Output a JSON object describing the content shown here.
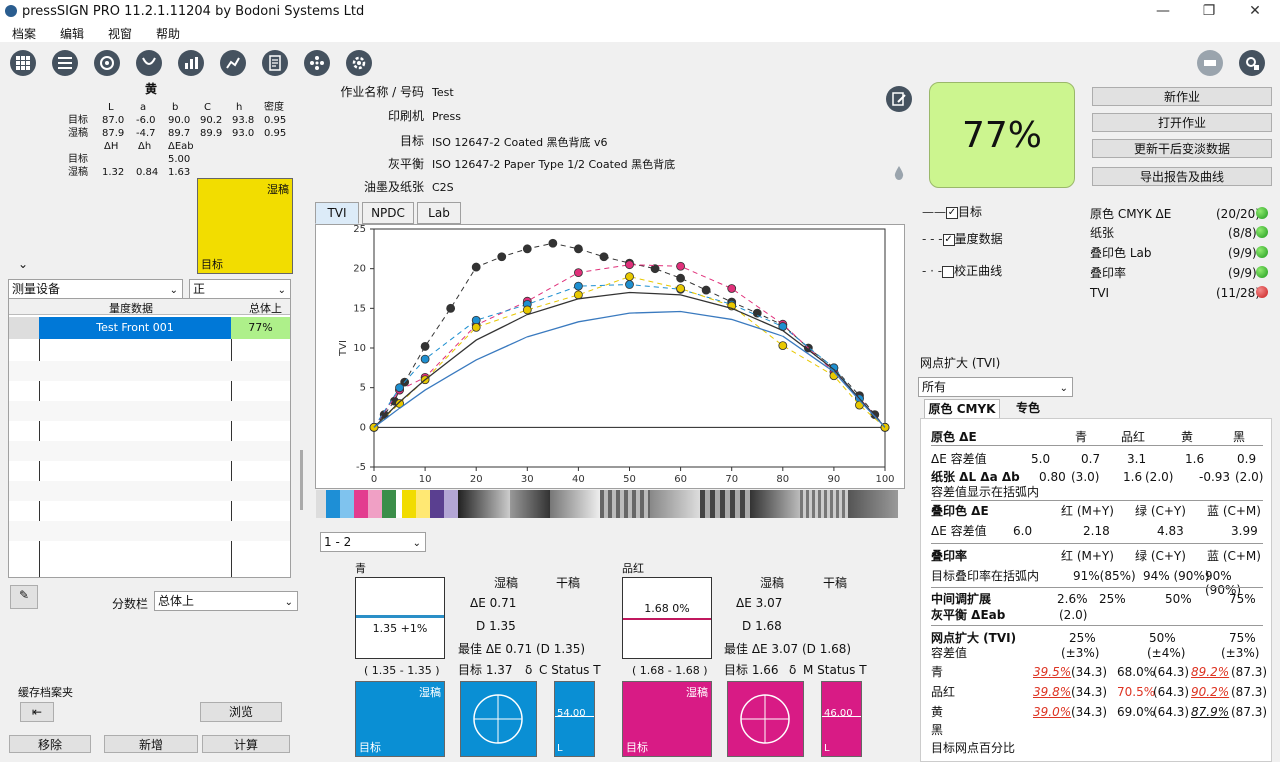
{
  "app": {
    "title": "pressSIGN PRO 11.2.1.11204 by Bodoni Systems Ltd"
  },
  "menu": [
    "档案",
    "编辑",
    "视窗",
    "帮助"
  ],
  "left": {
    "color_name": "黄",
    "headers": [
      "L",
      "a",
      "b",
      "C",
      "h",
      "密度"
    ],
    "target_label": "目标",
    "target": [
      "87.0",
      "-6.0",
      "90.0",
      "90.2",
      "93.8",
      "0.95"
    ],
    "wet_label": "湿稿",
    "wet": [
      "87.9",
      "-4.7",
      "89.7",
      "89.9",
      "93.0",
      "0.95"
    ],
    "d_headers": [
      "ΔH",
      "Δh",
      "ΔEab"
    ],
    "d_target_label": "目标",
    "d_target": [
      "",
      "",
      "5.00"
    ],
    "d_wet_label": "湿稿",
    "d_wet": [
      "1.32",
      "0.84",
      "1.63"
    ],
    "swatch_wet": "湿稿",
    "swatch_target": "目标",
    "device": "测量设备",
    "side": "正",
    "list_h1": "量度数据",
    "list_h2": "总体上",
    "row_name": "Test Front 001",
    "row_score": "77%",
    "score_label": "分数栏",
    "score_value": "总体上",
    "cache_label": "缓存档案夹",
    "browse": "浏览",
    "remove": "移除",
    "add": "新增",
    "calc": "计算"
  },
  "job": {
    "name_label": "作业名称 / 号码",
    "name": "Test",
    "press_label": "印刷机",
    "press": "Press",
    "target_label": "目标",
    "target": "ISO 12647-2 Coated 黑色背底 v6",
    "gray_label": "灰平衡",
    "gray": "ISO 12647-2 Paper Type 1/2 Coated 黑色背底",
    "ink_label": "油墨及纸张",
    "ink": "C2S"
  },
  "score": "77%",
  "buttons": [
    "新作业",
    "打开作业",
    "更新干后变淡数据",
    "导出报告及曲线"
  ],
  "tabs": [
    "TVI",
    "NPDC",
    "Lab"
  ],
  "chart_data": {
    "type": "line",
    "ylabel": "TVI",
    "xlim": [
      0,
      100
    ],
    "ylim": [
      -5,
      25
    ],
    "xticks": [
      0,
      10,
      20,
      30,
      40,
      50,
      60,
      70,
      80,
      90,
      100
    ],
    "yticks": [
      -5,
      0,
      5,
      10,
      15,
      20,
      25
    ],
    "x": [
      0,
      2,
      4,
      5,
      6,
      10,
      15,
      20,
      25,
      30,
      35,
      40,
      45,
      50,
      55,
      60,
      65,
      70,
      75,
      80,
      85,
      90,
      95,
      98,
      100
    ],
    "series": [
      {
        "color": "#333333",
        "dashed": true,
        "values": [
          0,
          1.6,
          3.3,
          4.7,
          5.7,
          10.2,
          15,
          20.2,
          21.5,
          22.5,
          23.2,
          22.5,
          21.5,
          20.7,
          20,
          18.8,
          17.3,
          15.8,
          14.4,
          12.9,
          10,
          7.5,
          4,
          1.6,
          0
        ]
      },
      {
        "color": "#e0307a",
        "dashed": true,
        "values": [
          0,
          null,
          null,
          4.7,
          null,
          6.3,
          null,
          12.9,
          null,
          15.9,
          null,
          19.5,
          null,
          20.5,
          null,
          20.3,
          null,
          17.5,
          null,
          13,
          null,
          7,
          3.7,
          null,
          0
        ]
      },
      {
        "color": "#1e8fd0",
        "dashed": true,
        "values": [
          0,
          null,
          null,
          5,
          null,
          8.6,
          null,
          13.5,
          null,
          15.5,
          null,
          17.8,
          null,
          18,
          null,
          17.4,
          null,
          15.5,
          null,
          12.7,
          null,
          7.5,
          3.6,
          null,
          0
        ]
      },
      {
        "color": "#e8c800",
        "dashed": true,
        "values": [
          0,
          null,
          null,
          3,
          null,
          6,
          null,
          12.6,
          null,
          14.8,
          null,
          16.7,
          null,
          19,
          null,
          17.5,
          null,
          15.3,
          null,
          10.3,
          null,
          6.5,
          2.8,
          null,
          0
        ]
      },
      {
        "color": "#333333",
        "dashed": false,
        "values": [
          0,
          null,
          null,
          3.2,
          null,
          6,
          null,
          11,
          null,
          14.2,
          null,
          16.2,
          null,
          17,
          null,
          16.7,
          null,
          15,
          null,
          12.2,
          null,
          7.3,
          3.6,
          null,
          0
        ]
      },
      {
        "color": "#3a7abf",
        "dashed": false,
        "values": [
          0,
          null,
          null,
          2.4,
          null,
          4.7,
          null,
          8.5,
          null,
          11.4,
          null,
          13.3,
          null,
          14.4,
          null,
          14.6,
          null,
          13.6,
          null,
          11.5,
          null,
          7,
          3.4,
          null,
          0
        ]
      }
    ]
  },
  "range_select": "1 - 2",
  "cyan": {
    "name": "青",
    "wet": "湿稿",
    "dry": "干稿",
    "de_label": "ΔE",
    "de": "0.71",
    "d_label": "D",
    "d": "1.35",
    "best": "最佳 ΔE 0.71 (D 1.35)",
    "target": "目标 1.37",
    "delta": "δ",
    "status": "C Status T",
    "box_val": "1.35 +1%",
    "range": "( 1.35 - 1.35 )",
    "sw_wet": "湿稿",
    "sw_target": "目标",
    "bar_val": "54.00",
    "bar_l": "L",
    "color": "#0a8fd4"
  },
  "magenta": {
    "name": "品红",
    "wet": "湿稿",
    "dry": "干稿",
    "de_label": "ΔE",
    "de": "3.07",
    "d_label": "D",
    "d": "1.68",
    "best": "最佳 ΔE 3.07 (D 1.68)",
    "target": "目标 1.66",
    "delta": "δ",
    "status": "M Status T",
    "box_val": "1.68 0%",
    "range": "( 1.68 - 1.68 )",
    "sw_wet": "湿稿",
    "sw_target": "目标",
    "bar_val": "46.00",
    "bar_l": "L",
    "color": "#d81b85"
  },
  "checks": [
    {
      "label": "目标",
      "checked": true
    },
    {
      "label": "量度数据",
      "checked": true
    },
    {
      "label": "校正曲线",
      "checked": false
    }
  ],
  "status": [
    {
      "label": "原色 CMYK ΔE",
      "value": "(20/20)",
      "ok": true
    },
    {
      "label": "纸张",
      "value": "(8/8)",
      "ok": true
    },
    {
      "label": "叠印色 Lab",
      "value": "(9/9)",
      "ok": true
    },
    {
      "label": "叠印率",
      "value": "(9/9)",
      "ok": true
    },
    {
      "label": "TVI",
      "value": "(11/28)",
      "ok": false
    }
  ],
  "dot_gain": {
    "title": "网点扩大 (TVI)",
    "select": "所有",
    "tab1": "原色 CMYK",
    "tab2": "专色"
  },
  "report": {
    "r1": [
      "原色 ΔE",
      "青",
      "品红",
      "黄",
      "黑"
    ],
    "r2": [
      "ΔE 容差值",
      "5.0",
      "0.7",
      "3.1",
      "1.6",
      "0.9"
    ],
    "r3": [
      "纸张 ΔL Δa Δb",
      "0.80",
      "(3.0)",
      "1.6",
      "(2.0)",
      "-0.93",
      "(2.0)"
    ],
    "r4": "容差值显示在括弧内",
    "r5": [
      "叠印色 ΔE",
      "红 (M+Y)",
      "绿 (C+Y)",
      "蓝 (C+M)"
    ],
    "r6": [
      "ΔE 容差值",
      "6.0",
      "2.18",
      "4.83",
      "3.99"
    ],
    "r7": [
      "叠印率",
      "红 (M+Y)",
      "绿 (C+Y)",
      "蓝 (C+M)"
    ],
    "r8": [
      "目标叠印率在括弧内",
      "91%(85%)",
      "94% (90%)",
      "90% (90%)"
    ],
    "r9": [
      "中间调扩展",
      "2.6%",
      "25%",
      "50%",
      "75%"
    ],
    "r10": [
      "灰平衡 ΔEab",
      "(2.0)"
    ],
    "r11": [
      "网点扩大 (TVI)",
      "25%",
      "50%",
      "75%"
    ],
    "r12": [
      "容差值",
      "(±3%)",
      "(±4%)",
      "(±3%)"
    ],
    "tvi_rows": [
      {
        "name": "青",
        "v": [
          "39.5%",
          "(34.3)",
          "68.0%",
          "(64.3)",
          "89.2%",
          "(87.3)"
        ]
      },
      {
        "name": "品红",
        "v": [
          "39.8%",
          "(34.3)",
          "70.5%",
          "(64.3)",
          "90.2%",
          "(87.3)"
        ]
      },
      {
        "name": "黄",
        "v": [
          "39.0%",
          "(34.3)",
          "69.0%",
          "(64.3)",
          "87.9%",
          "(87.3)"
        ]
      },
      {
        "name": "黑",
        "v": [
          "",
          "",
          "",
          "",
          "",
          ""
        ]
      }
    ],
    "last": "目标网点百分比"
  }
}
